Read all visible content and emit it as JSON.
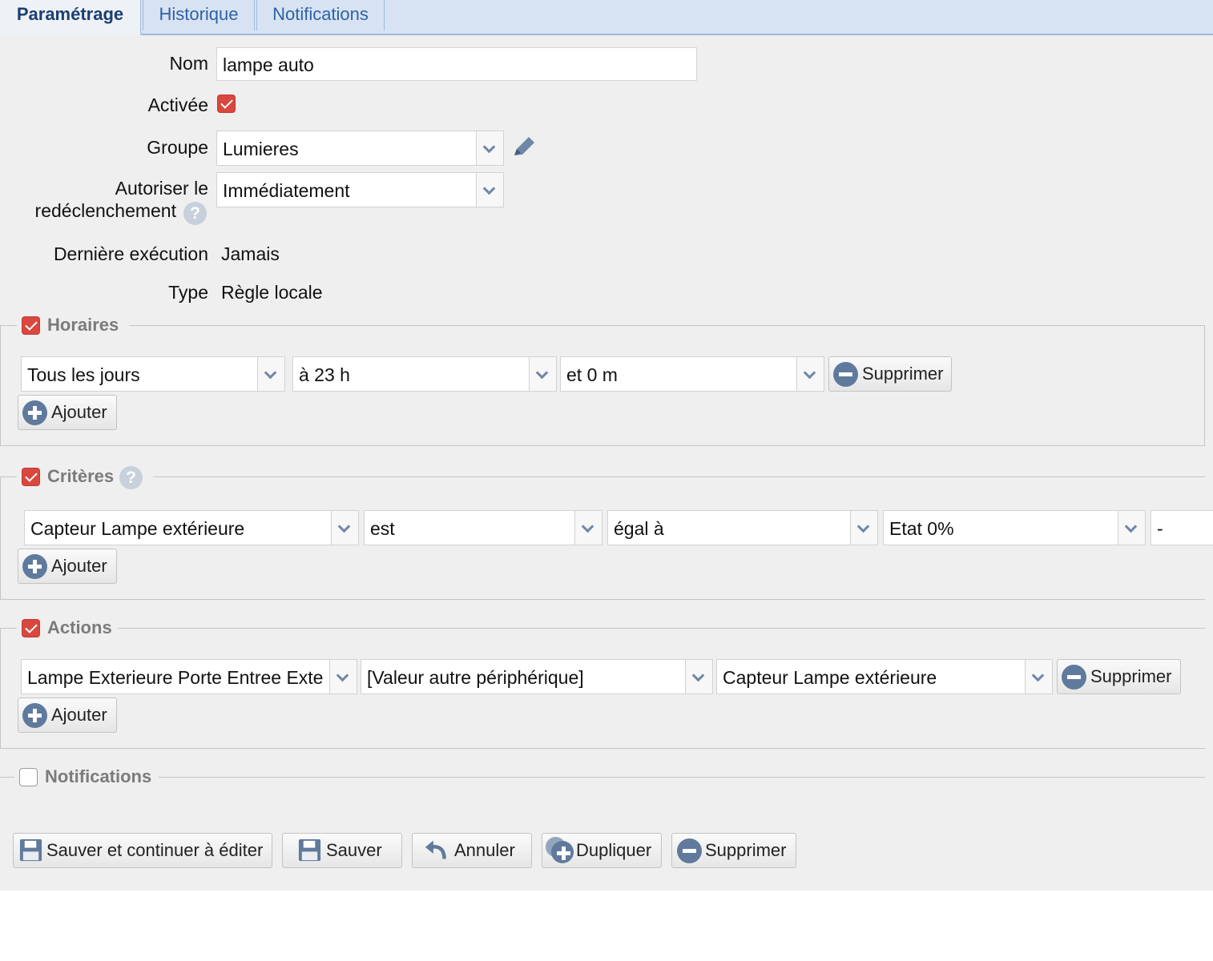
{
  "tabs": [
    {
      "label": "Paramétrage",
      "active": true
    },
    {
      "label": "Historique",
      "active": false
    },
    {
      "label": "Notifications",
      "active": false
    }
  ],
  "form": {
    "nom_label": "Nom",
    "nom_value": "lampe auto",
    "activee_label": "Activée",
    "activee_checked": true,
    "groupe_label": "Groupe",
    "groupe_value": "Lumieres",
    "autoriser_label_1": "Autoriser le",
    "autoriser_label_2": "redéclenchement",
    "autoriser_value": "Immédiatement",
    "derniere_label": "Dernière exécution",
    "derniere_value": "Jamais",
    "type_label": "Type",
    "type_value": "Règle locale"
  },
  "horaires": {
    "legend": "Horaires",
    "enabled": true,
    "day": "Tous les jours",
    "hour": "à 23 h",
    "minute": "et 0 m",
    "remove_label": "Supprimer",
    "add_label": "Ajouter"
  },
  "criteres": {
    "legend": "Critères",
    "enabled": true,
    "device": "Capteur Lampe extérieure",
    "verb": "est",
    "operator": "égal à",
    "state": "Etat 0%",
    "extra": "-",
    "add_label": "Ajouter"
  },
  "actions": {
    "legend": "Actions",
    "enabled": true,
    "target": "Lampe Exterieure Porte Entree Exte",
    "value_type": "[Valeur autre périphérique]",
    "source": "Capteur Lampe extérieure",
    "remove_label": "Supprimer",
    "add_label": "Ajouter"
  },
  "notifications": {
    "legend": "Notifications",
    "enabled": false
  },
  "footer": {
    "save_continue": "Sauver et continuer à éditer",
    "save": "Sauver",
    "cancel": "Annuler",
    "duplicate": "Dupliquer",
    "delete": "Supprimer"
  },
  "colors": {
    "tab_bg": "#d7e3f2",
    "tab_text": "#2f62a6",
    "checkbox_on": "#d9473f",
    "icon": "#5f7a9c"
  }
}
